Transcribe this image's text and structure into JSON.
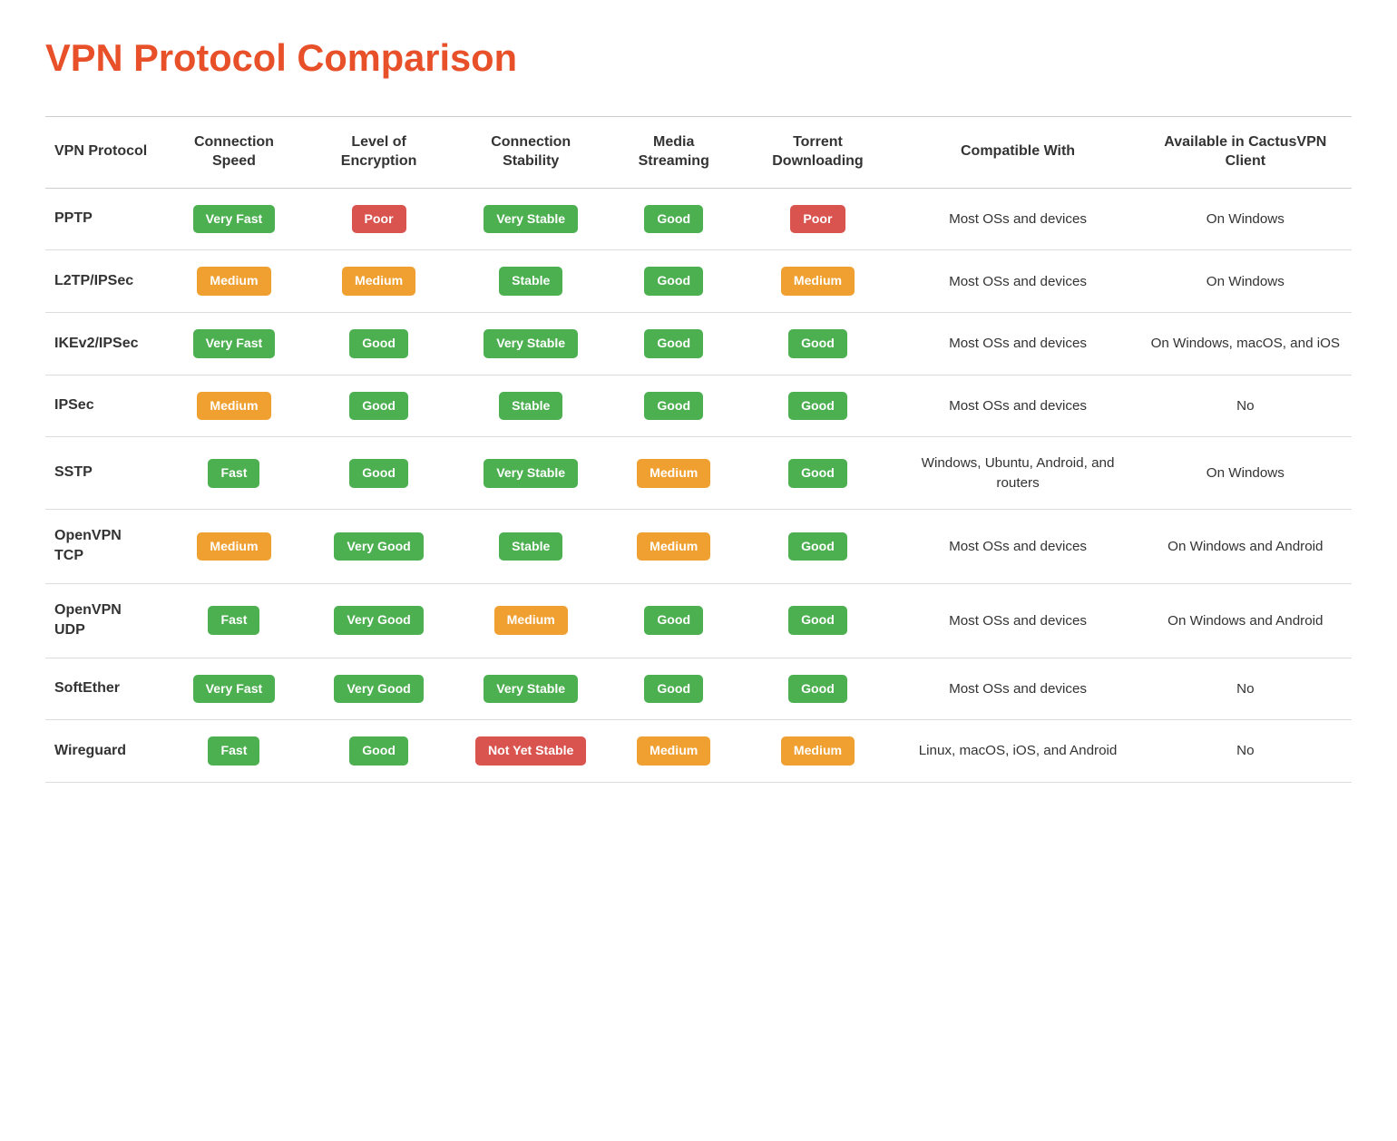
{
  "title": "VPN Protocol Comparison",
  "columns": [
    "VPN Protocol",
    "Connection Speed",
    "Level of Encryption",
    "Connection Stability",
    "Media Streaming",
    "Torrent Downloading",
    "Compatible With",
    "Available in CactusVPN Client"
  ],
  "rows": [
    {
      "protocol": "PPTP",
      "speed": {
        "label": "Very Fast",
        "type": "green"
      },
      "encryption": {
        "label": "Poor",
        "type": "red"
      },
      "stability": {
        "label": "Very Stable",
        "type": "green"
      },
      "streaming": {
        "label": "Good",
        "type": "green"
      },
      "torrent": {
        "label": "Poor",
        "type": "red"
      },
      "compatible": "Most OSs and devices",
      "available": "On Windows"
    },
    {
      "protocol": "L2TP/IPSec",
      "speed": {
        "label": "Medium",
        "type": "orange"
      },
      "encryption": {
        "label": "Medium",
        "type": "orange"
      },
      "stability": {
        "label": "Stable",
        "type": "green"
      },
      "streaming": {
        "label": "Good",
        "type": "green"
      },
      "torrent": {
        "label": "Medium",
        "type": "orange"
      },
      "compatible": "Most OSs and devices",
      "available": "On Windows"
    },
    {
      "protocol": "IKEv2/IPSec",
      "speed": {
        "label": "Very Fast",
        "type": "green"
      },
      "encryption": {
        "label": "Good",
        "type": "green"
      },
      "stability": {
        "label": "Very Stable",
        "type": "green"
      },
      "streaming": {
        "label": "Good",
        "type": "green"
      },
      "torrent": {
        "label": "Good",
        "type": "green"
      },
      "compatible": "Most OSs and devices",
      "available": "On Windows, macOS, and iOS"
    },
    {
      "protocol": "IPSec",
      "speed": {
        "label": "Medium",
        "type": "orange"
      },
      "encryption": {
        "label": "Good",
        "type": "green"
      },
      "stability": {
        "label": "Stable",
        "type": "green"
      },
      "streaming": {
        "label": "Good",
        "type": "green"
      },
      "torrent": {
        "label": "Good",
        "type": "green"
      },
      "compatible": "Most OSs and devices",
      "available": "No"
    },
    {
      "protocol": "SSTP",
      "speed": {
        "label": "Fast",
        "type": "green"
      },
      "encryption": {
        "label": "Good",
        "type": "green"
      },
      "stability": {
        "label": "Very Stable",
        "type": "green"
      },
      "streaming": {
        "label": "Medium",
        "type": "orange"
      },
      "torrent": {
        "label": "Good",
        "type": "green"
      },
      "compatible": "Windows, Ubuntu, Android, and routers",
      "available": "On Windows"
    },
    {
      "protocol": "OpenVPN TCP",
      "speed": {
        "label": "Medium",
        "type": "orange"
      },
      "encryption": {
        "label": "Very Good",
        "type": "green"
      },
      "stability": {
        "label": "Stable",
        "type": "green"
      },
      "streaming": {
        "label": "Medium",
        "type": "orange"
      },
      "torrent": {
        "label": "Good",
        "type": "green"
      },
      "compatible": "Most OSs and devices",
      "available": "On Windows and Android"
    },
    {
      "protocol": "OpenVPN UDP",
      "speed": {
        "label": "Fast",
        "type": "green"
      },
      "encryption": {
        "label": "Very Good",
        "type": "green"
      },
      "stability": {
        "label": "Medium",
        "type": "orange"
      },
      "streaming": {
        "label": "Good",
        "type": "green"
      },
      "torrent": {
        "label": "Good",
        "type": "green"
      },
      "compatible": "Most OSs and devices",
      "available": "On Windows and Android"
    },
    {
      "protocol": "SoftEther",
      "speed": {
        "label": "Very Fast",
        "type": "green"
      },
      "encryption": {
        "label": "Very Good",
        "type": "green"
      },
      "stability": {
        "label": "Very Stable",
        "type": "green"
      },
      "streaming": {
        "label": "Good",
        "type": "green"
      },
      "torrent": {
        "label": "Good",
        "type": "green"
      },
      "compatible": "Most OSs and devices",
      "available": "No"
    },
    {
      "protocol": "Wireguard",
      "speed": {
        "label": "Fast",
        "type": "green"
      },
      "encryption": {
        "label": "Good",
        "type": "green"
      },
      "stability": {
        "label": "Not Yet Stable",
        "type": "red"
      },
      "streaming": {
        "label": "Medium",
        "type": "orange"
      },
      "torrent": {
        "label": "Medium",
        "type": "orange"
      },
      "compatible": "Linux, macOS, iOS, and Android",
      "available": "No"
    }
  ]
}
